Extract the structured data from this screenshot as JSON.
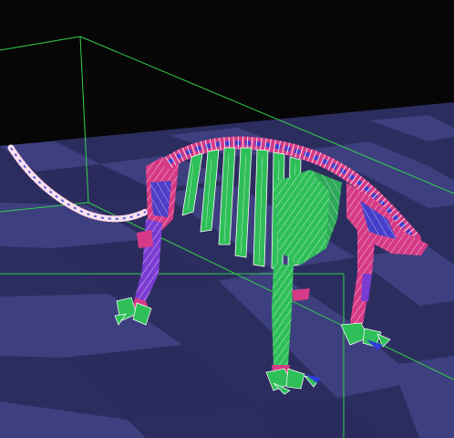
{
  "scene": {
    "subject": "skeleton-model",
    "render_mode": "wireframe",
    "background_color": "#060606",
    "floor_light_color": "#3b3d7a",
    "floor_dark_color": "#2a2b5c",
    "bounding_box_color": "#33d04a"
  },
  "colors": {
    "ribs_bone": "#2fbf58",
    "spine_bone": "#d63a86",
    "limb_bone": "#7b3bd3",
    "highlight_blue": "#2d3dd6",
    "wire": "#ffffff"
  }
}
